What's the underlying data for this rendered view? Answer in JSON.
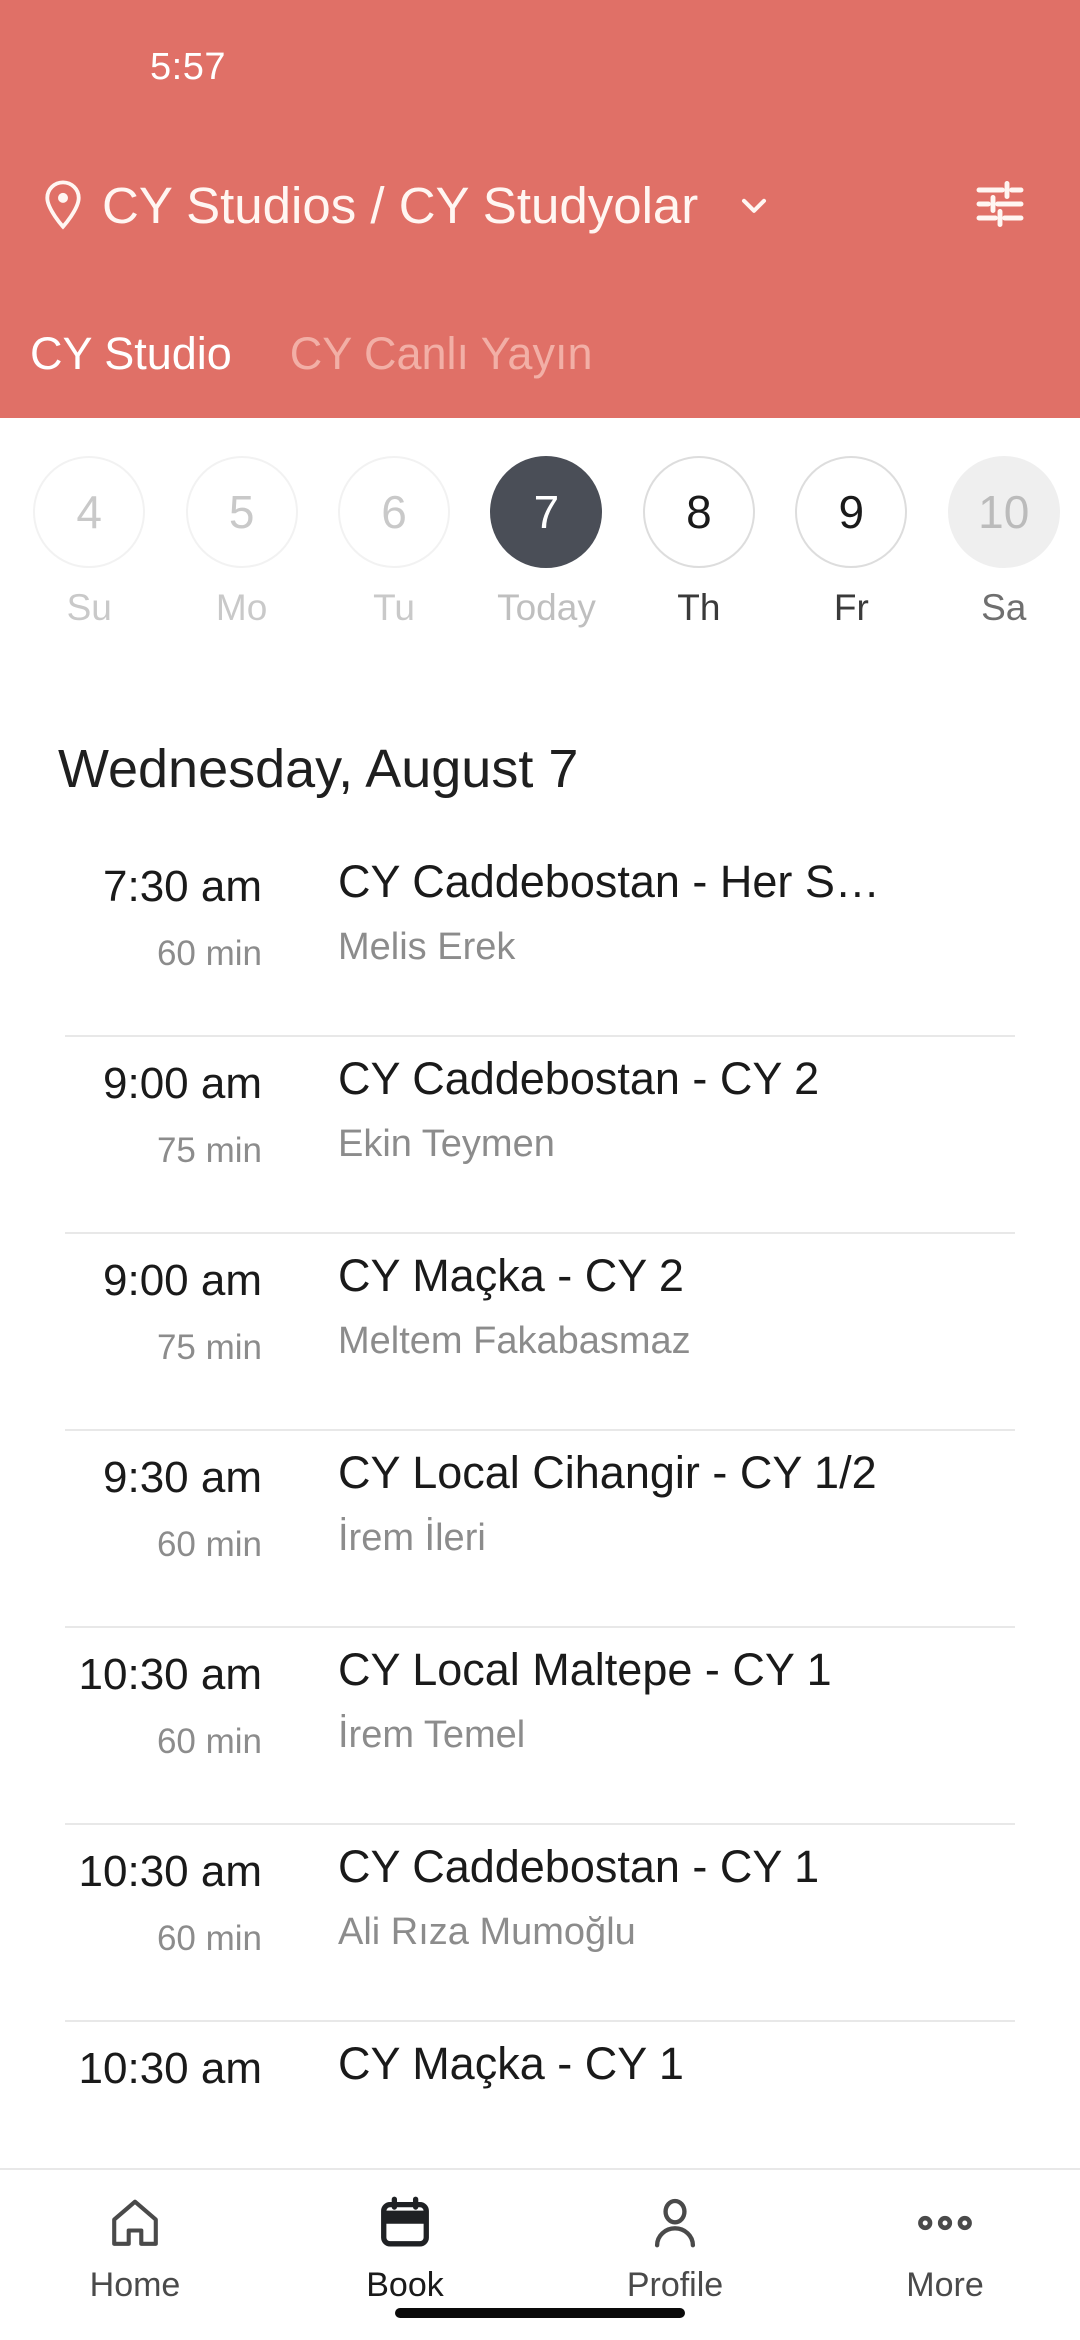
{
  "theme": {
    "header_bg": "#E07067",
    "today_pill_bg": "#4A4E57",
    "muted_text": "#8C8C8C",
    "divider": "#E8E8E8"
  },
  "status_bar": {
    "time": "5:57"
  },
  "header": {
    "location_icon": "location-pin-icon",
    "location_title": "CY Studios / CY Studyolar",
    "chevron_icon": "chevron-down-icon",
    "filter_icon": "filter-sliders-icon",
    "tabs": [
      {
        "label": "CY Studio",
        "active": true
      },
      {
        "label": "CY Canlı Yayın",
        "active": false
      }
    ]
  },
  "date_strip": {
    "days": [
      {
        "number": "4",
        "label": "Su",
        "state": "past"
      },
      {
        "number": "5",
        "label": "Mo",
        "state": "past"
      },
      {
        "number": "6",
        "label": "Tu",
        "state": "past"
      },
      {
        "number": "7",
        "label": "Today",
        "state": "today"
      },
      {
        "number": "8",
        "label": "Th",
        "state": "normal"
      },
      {
        "number": "9",
        "label": "Fr",
        "state": "normal"
      },
      {
        "number": "10",
        "label": "Sa",
        "state": "pressed"
      }
    ]
  },
  "schedule": {
    "day_title": "Wednesday, August 7",
    "classes": [
      {
        "time": "7:30 am",
        "duration": "60 min",
        "name": "CY Caddebostan - Her S…",
        "teacher": "Melis Erek"
      },
      {
        "time": "9:00 am",
        "duration": "75 min",
        "name": "CY Caddebostan - CY 2",
        "teacher": "Ekin Teymen"
      },
      {
        "time": "9:00 am",
        "duration": "75 min",
        "name": "CY Maçka - CY 2",
        "teacher": "Meltem Fakabasmaz"
      },
      {
        "time": "9:30 am",
        "duration": "60 min",
        "name": "CY Local Cihangir - CY 1/2",
        "teacher": "İrem İleri"
      },
      {
        "time": "10:30 am",
        "duration": "60 min",
        "name": "CY Local Maltepe - CY 1",
        "teacher": "İrem Temel"
      },
      {
        "time": "10:30 am",
        "duration": "60 min",
        "name": "CY Caddebostan - CY 1",
        "teacher": "Ali Rıza Mumoğlu"
      },
      {
        "time": "10:30 am",
        "duration": "",
        "name": "CY Maçka - CY 1",
        "teacher": ""
      }
    ]
  },
  "bottom_nav": {
    "items": [
      {
        "label": "Home",
        "icon": "home-icon",
        "active": false
      },
      {
        "label": "Book",
        "icon": "calendar-icon",
        "active": true
      },
      {
        "label": "Profile",
        "icon": "person-icon",
        "active": false
      },
      {
        "label": "More",
        "icon": "more-dots-icon",
        "active": false
      }
    ]
  }
}
